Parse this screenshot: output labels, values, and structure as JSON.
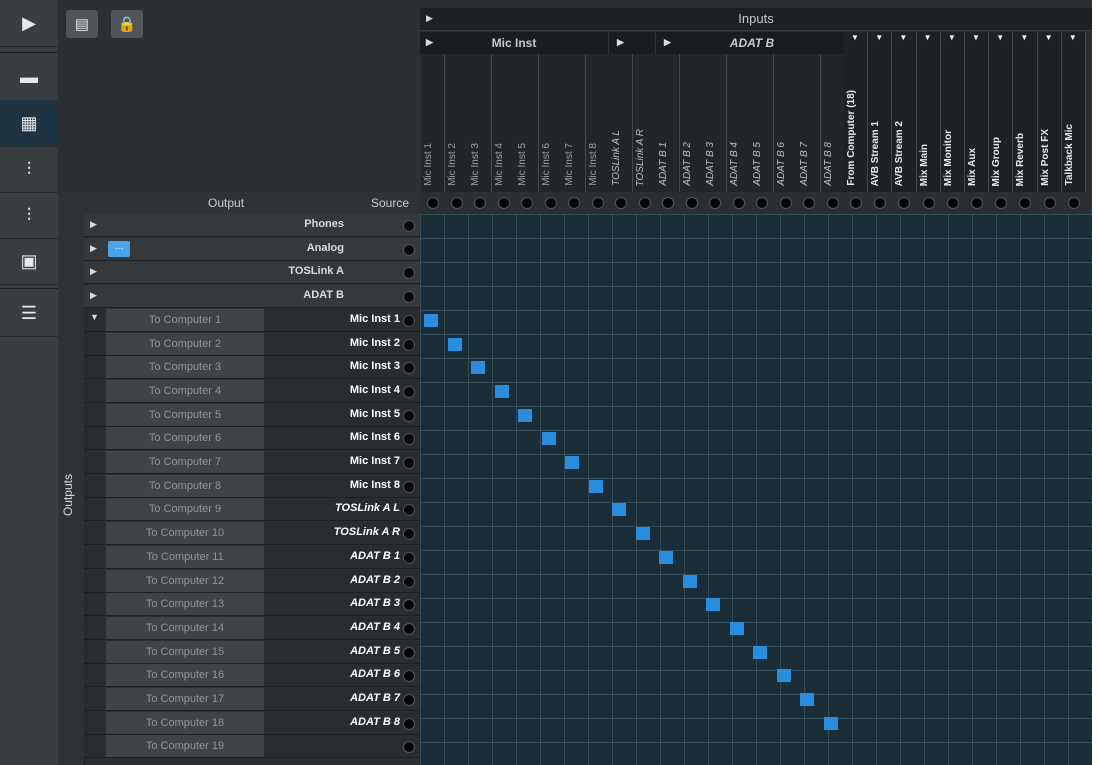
{
  "sidebar": {
    "items": [
      {
        "icon": "play-icon",
        "glyph": "▶"
      },
      {
        "icon": "device-icon",
        "glyph": "▬"
      },
      {
        "icon": "routing-grid-icon",
        "glyph": "▦",
        "active": true
      },
      {
        "icon": "mixer-icon",
        "glyph": "⫶"
      },
      {
        "icon": "user-mixer-icon",
        "glyph": "⫶"
      },
      {
        "icon": "touch-screen-icon",
        "glyph": "▣"
      },
      {
        "icon": "list-icon",
        "glyph": "☰"
      }
    ]
  },
  "toolbar": {
    "buttons": [
      {
        "icon": "copy-icon",
        "glyph": "▤"
      },
      {
        "icon": "lock-icon",
        "glyph": "🔒"
      }
    ]
  },
  "inputs": {
    "title": "Inputs",
    "groups": [
      {
        "label": "Mic Inst"
      },
      {
        "label": "ADAT B"
      }
    ],
    "columns": [
      {
        "label": "Mic Inst 1",
        "style": "normal"
      },
      {
        "label": "Mic Inst 2",
        "style": "normal"
      },
      {
        "label": "Mic Inst 3",
        "style": "normal"
      },
      {
        "label": "Mic Inst 4",
        "style": "normal"
      },
      {
        "label": "Mic Inst 5",
        "style": "normal"
      },
      {
        "label": "Mic Inst 6",
        "style": "normal"
      },
      {
        "label": "Mic Inst 7",
        "style": "normal"
      },
      {
        "label": "Mic Inst 8",
        "style": "normal"
      },
      {
        "label": "TOSLink A L",
        "style": "italic"
      },
      {
        "label": "TOSLink A R",
        "style": "italic"
      },
      {
        "label": "ADAT B 1",
        "style": "italic"
      },
      {
        "label": "ADAT B 2",
        "style": "italic"
      },
      {
        "label": "ADAT B 3",
        "style": "italic"
      },
      {
        "label": "ADAT B 4",
        "style": "italic"
      },
      {
        "label": "ADAT B 5",
        "style": "italic"
      },
      {
        "label": "ADAT B 6",
        "style": "italic"
      },
      {
        "label": "ADAT B 7",
        "style": "italic"
      },
      {
        "label": "ADAT B 8",
        "style": "italic"
      }
    ],
    "right_columns": [
      {
        "label": "From Computer (18)"
      },
      {
        "label": "AVB Stream 1"
      },
      {
        "label": "AVB Stream 2"
      },
      {
        "label": "Mix Main"
      },
      {
        "label": "Mix Monitor"
      },
      {
        "label": "Mix Aux"
      },
      {
        "label": "Mix Group"
      },
      {
        "label": "Mix Reverb"
      },
      {
        "label": "Mix Post FX"
      },
      {
        "label": "Talkback Mic"
      }
    ]
  },
  "outputs": {
    "label": "Outputs",
    "output_header": "Output",
    "source_header": "Source",
    "groups": [
      {
        "label": "Phones"
      },
      {
        "label": "Analog",
        "more": "..."
      },
      {
        "label": "TOSLink A"
      },
      {
        "label": "ADAT B"
      }
    ],
    "rows": [
      {
        "output": "To Computer 1",
        "source": "Mic Inst 1",
        "italic": false,
        "route": 0
      },
      {
        "output": "To Computer 2",
        "source": "Mic Inst 2",
        "italic": false,
        "route": 1
      },
      {
        "output": "To Computer 3",
        "source": "Mic Inst 3",
        "italic": false,
        "route": 2
      },
      {
        "output": "To Computer 4",
        "source": "Mic Inst 4",
        "italic": false,
        "route": 3
      },
      {
        "output": "To Computer 5",
        "source": "Mic Inst 5",
        "italic": false,
        "route": 4
      },
      {
        "output": "To Computer 6",
        "source": "Mic Inst 6",
        "italic": false,
        "route": 5
      },
      {
        "output": "To Computer 7",
        "source": "Mic Inst 7",
        "italic": false,
        "route": 6
      },
      {
        "output": "To Computer 8",
        "source": "Mic Inst 8",
        "italic": false,
        "route": 7
      },
      {
        "output": "To Computer 9",
        "source": "TOSLink A L",
        "italic": true,
        "route": 8
      },
      {
        "output": "To Computer 10",
        "source": "TOSLink A R",
        "italic": true,
        "route": 9
      },
      {
        "output": "To Computer 11",
        "source": "ADAT B 1",
        "italic": true,
        "route": 10
      },
      {
        "output": "To Computer 12",
        "source": "ADAT B 2",
        "italic": true,
        "route": 11
      },
      {
        "output": "To Computer 13",
        "source": "ADAT B 3",
        "italic": true,
        "route": 12
      },
      {
        "output": "To Computer 14",
        "source": "ADAT B 4",
        "italic": true,
        "route": 13
      },
      {
        "output": "To Computer 15",
        "source": "ADAT B 5",
        "italic": true,
        "route": 14
      },
      {
        "output": "To Computer 16",
        "source": "ADAT B 6",
        "italic": true,
        "route": 15
      },
      {
        "output": "To Computer 17",
        "source": "ADAT B 7",
        "italic": true,
        "route": 16
      },
      {
        "output": "To Computer 18",
        "source": "ADAT B 8",
        "italic": true,
        "route": 17
      },
      {
        "output": "To Computer 19",
        "source": "",
        "italic": false,
        "route": null
      }
    ]
  },
  "colors": {
    "route": "#2a8ee0",
    "matrix_bg": "#1b2e38"
  }
}
